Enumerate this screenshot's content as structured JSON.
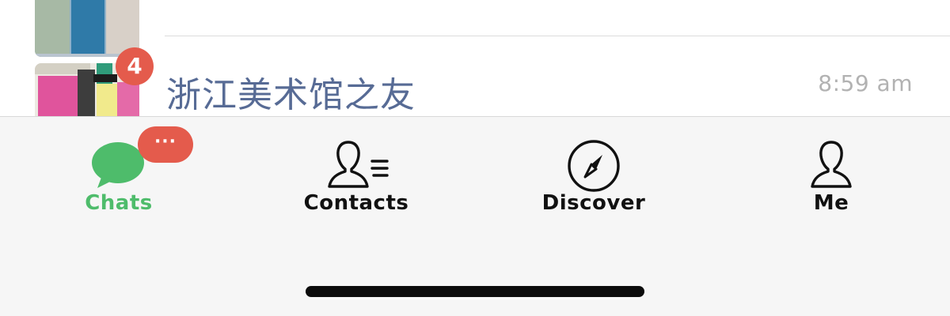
{
  "chat_list": {
    "items": [
      {
        "name": "浙江美术馆之友",
        "time": "8:59 am",
        "unread_count": "4"
      }
    ]
  },
  "tab_bar": {
    "tabs": [
      {
        "label": "Chats",
        "icon": "chat-bubble-icon",
        "active": true
      },
      {
        "label": "Contacts",
        "icon": "contacts-icon",
        "active": false
      },
      {
        "label": "Discover",
        "icon": "compass-icon",
        "active": false
      },
      {
        "label": "Me",
        "icon": "person-icon",
        "active": false
      }
    ],
    "more_badge": "···"
  },
  "colors": {
    "accent_green": "#4ebc6b",
    "badge_red": "#e45b4c",
    "chat_name_blue": "#576b95",
    "time_gray": "#b2b2b2"
  }
}
